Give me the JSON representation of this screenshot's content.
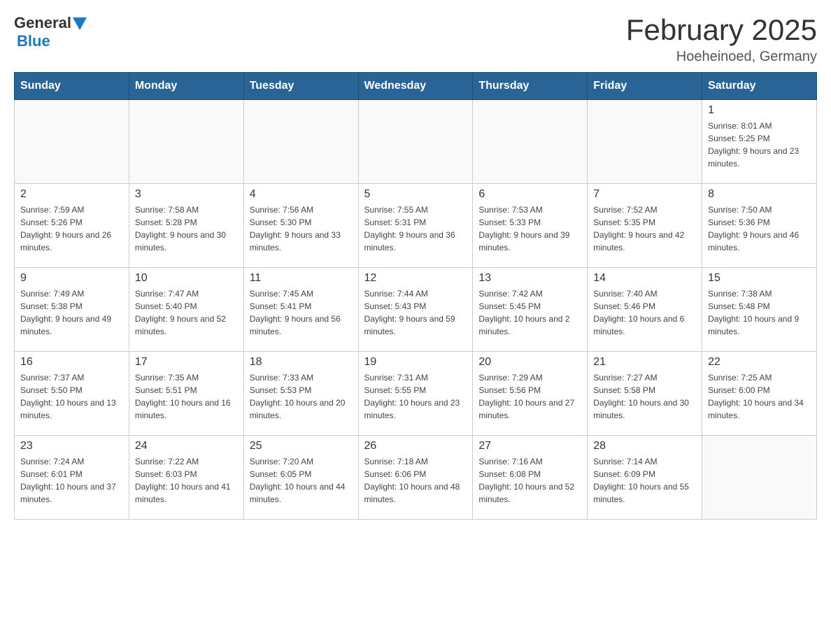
{
  "header": {
    "logo_general": "General",
    "logo_blue": "Blue",
    "title": "February 2025",
    "subtitle": "Hoeheinoed, Germany"
  },
  "weekdays": [
    "Sunday",
    "Monday",
    "Tuesday",
    "Wednesday",
    "Thursday",
    "Friday",
    "Saturday"
  ],
  "weeks": [
    [
      {
        "day": "",
        "info": ""
      },
      {
        "day": "",
        "info": ""
      },
      {
        "day": "",
        "info": ""
      },
      {
        "day": "",
        "info": ""
      },
      {
        "day": "",
        "info": ""
      },
      {
        "day": "",
        "info": ""
      },
      {
        "day": "1",
        "info": "Sunrise: 8:01 AM\nSunset: 5:25 PM\nDaylight: 9 hours and 23 minutes."
      }
    ],
    [
      {
        "day": "2",
        "info": "Sunrise: 7:59 AM\nSunset: 5:26 PM\nDaylight: 9 hours and 26 minutes."
      },
      {
        "day": "3",
        "info": "Sunrise: 7:58 AM\nSunset: 5:28 PM\nDaylight: 9 hours and 30 minutes."
      },
      {
        "day": "4",
        "info": "Sunrise: 7:56 AM\nSunset: 5:30 PM\nDaylight: 9 hours and 33 minutes."
      },
      {
        "day": "5",
        "info": "Sunrise: 7:55 AM\nSunset: 5:31 PM\nDaylight: 9 hours and 36 minutes."
      },
      {
        "day": "6",
        "info": "Sunrise: 7:53 AM\nSunset: 5:33 PM\nDaylight: 9 hours and 39 minutes."
      },
      {
        "day": "7",
        "info": "Sunrise: 7:52 AM\nSunset: 5:35 PM\nDaylight: 9 hours and 42 minutes."
      },
      {
        "day": "8",
        "info": "Sunrise: 7:50 AM\nSunset: 5:36 PM\nDaylight: 9 hours and 46 minutes."
      }
    ],
    [
      {
        "day": "9",
        "info": "Sunrise: 7:49 AM\nSunset: 5:38 PM\nDaylight: 9 hours and 49 minutes."
      },
      {
        "day": "10",
        "info": "Sunrise: 7:47 AM\nSunset: 5:40 PM\nDaylight: 9 hours and 52 minutes."
      },
      {
        "day": "11",
        "info": "Sunrise: 7:45 AM\nSunset: 5:41 PM\nDaylight: 9 hours and 56 minutes."
      },
      {
        "day": "12",
        "info": "Sunrise: 7:44 AM\nSunset: 5:43 PM\nDaylight: 9 hours and 59 minutes."
      },
      {
        "day": "13",
        "info": "Sunrise: 7:42 AM\nSunset: 5:45 PM\nDaylight: 10 hours and 2 minutes."
      },
      {
        "day": "14",
        "info": "Sunrise: 7:40 AM\nSunset: 5:46 PM\nDaylight: 10 hours and 6 minutes."
      },
      {
        "day": "15",
        "info": "Sunrise: 7:38 AM\nSunset: 5:48 PM\nDaylight: 10 hours and 9 minutes."
      }
    ],
    [
      {
        "day": "16",
        "info": "Sunrise: 7:37 AM\nSunset: 5:50 PM\nDaylight: 10 hours and 13 minutes."
      },
      {
        "day": "17",
        "info": "Sunrise: 7:35 AM\nSunset: 5:51 PM\nDaylight: 10 hours and 16 minutes."
      },
      {
        "day": "18",
        "info": "Sunrise: 7:33 AM\nSunset: 5:53 PM\nDaylight: 10 hours and 20 minutes."
      },
      {
        "day": "19",
        "info": "Sunrise: 7:31 AM\nSunset: 5:55 PM\nDaylight: 10 hours and 23 minutes."
      },
      {
        "day": "20",
        "info": "Sunrise: 7:29 AM\nSunset: 5:56 PM\nDaylight: 10 hours and 27 minutes."
      },
      {
        "day": "21",
        "info": "Sunrise: 7:27 AM\nSunset: 5:58 PM\nDaylight: 10 hours and 30 minutes."
      },
      {
        "day": "22",
        "info": "Sunrise: 7:25 AM\nSunset: 6:00 PM\nDaylight: 10 hours and 34 minutes."
      }
    ],
    [
      {
        "day": "23",
        "info": "Sunrise: 7:24 AM\nSunset: 6:01 PM\nDaylight: 10 hours and 37 minutes."
      },
      {
        "day": "24",
        "info": "Sunrise: 7:22 AM\nSunset: 6:03 PM\nDaylight: 10 hours and 41 minutes."
      },
      {
        "day": "25",
        "info": "Sunrise: 7:20 AM\nSunset: 6:05 PM\nDaylight: 10 hours and 44 minutes."
      },
      {
        "day": "26",
        "info": "Sunrise: 7:18 AM\nSunset: 6:06 PM\nDaylight: 10 hours and 48 minutes."
      },
      {
        "day": "27",
        "info": "Sunrise: 7:16 AM\nSunset: 6:08 PM\nDaylight: 10 hours and 52 minutes."
      },
      {
        "day": "28",
        "info": "Sunrise: 7:14 AM\nSunset: 6:09 PM\nDaylight: 10 hours and 55 minutes."
      },
      {
        "day": "",
        "info": ""
      }
    ]
  ]
}
